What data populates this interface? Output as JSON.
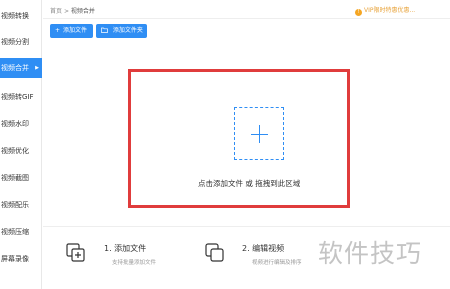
{
  "sidebar": {
    "items": [
      {
        "label": "视频转换",
        "active": false
      },
      {
        "label": "视频分割",
        "active": false
      },
      {
        "label": "视频合并",
        "active": true
      },
      {
        "label": "视频转GIF",
        "active": false
      },
      {
        "label": "视频水印",
        "active": false
      },
      {
        "label": "视频优化",
        "active": false
      },
      {
        "label": "视频截图",
        "active": false
      },
      {
        "label": "视频配乐",
        "active": false
      },
      {
        "label": "视频压缩",
        "active": false
      },
      {
        "label": "屏幕录像",
        "active": false
      }
    ],
    "active_arrow": "▶"
  },
  "breadcrumb": {
    "home": "首页",
    "separator": ">",
    "current": "视频合并"
  },
  "vip_notice": {
    "icon": "warning-icon",
    "text": "VIP限时特惠优惠..."
  },
  "toolbar": {
    "add_file_label": "添加文件",
    "add_folder_label": "添加文件夹"
  },
  "drop_zone": {
    "text": "点击添加文件 或 拖拽到此区域"
  },
  "steps": [
    {
      "title": "1. 添加文件",
      "desc": "支持批量添加文件"
    },
    {
      "title": "2. 编辑视频",
      "desc": "视频进行编辑及排序"
    }
  ],
  "watermark": "软件技巧",
  "colors": {
    "accent": "#2f8ef4",
    "highlight_frame": "#e03c3c",
    "vip": "#e8a33a"
  }
}
